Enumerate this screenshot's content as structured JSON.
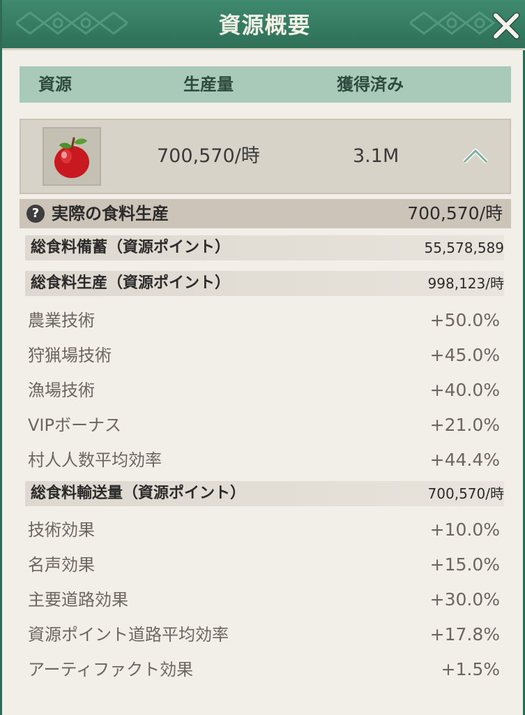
{
  "window": {
    "title": "資源概要"
  },
  "table_header": {
    "resource": "資源",
    "production": "生産量",
    "acquired": "獲得済み"
  },
  "resource": {
    "icon": "apple-icon",
    "production": "700,570/時",
    "acquired": "3.1M"
  },
  "actual": {
    "label": "実際の食料生産",
    "value": "700,570/時"
  },
  "storage": {
    "label": "総食料備蓄（資源ポイント）",
    "value": "55,578,589"
  },
  "production_section": {
    "label": "総食料生産（資源ポイント）",
    "value": "998,123/時",
    "items": [
      {
        "label": "農業技術",
        "value": "+50.0%"
      },
      {
        "label": "狩猟場技術",
        "value": "+45.0%"
      },
      {
        "label": "漁場技術",
        "value": "+40.0%"
      },
      {
        "label": "VIPボーナス",
        "value": "+21.0%"
      },
      {
        "label": "村人人数平均効率",
        "value": "+44.4%"
      }
    ]
  },
  "transport_section": {
    "label": "総食料輸送量（資源ポイント）",
    "value": "700,570/時",
    "items": [
      {
        "label": "技術効果",
        "value": "+10.0%"
      },
      {
        "label": "名声効果",
        "value": "+15.0%"
      },
      {
        "label": "主要道路効果",
        "value": "+30.0%"
      },
      {
        "label": "資源ポイント道路平均効率",
        "value": "+17.8%"
      },
      {
        "label": "アーティファクト効果",
        "value": "+1.5%"
      }
    ]
  },
  "colors": {
    "title_bar": "#3a8068",
    "header_row": "#a9cab8",
    "panel": "#f2efe8"
  }
}
